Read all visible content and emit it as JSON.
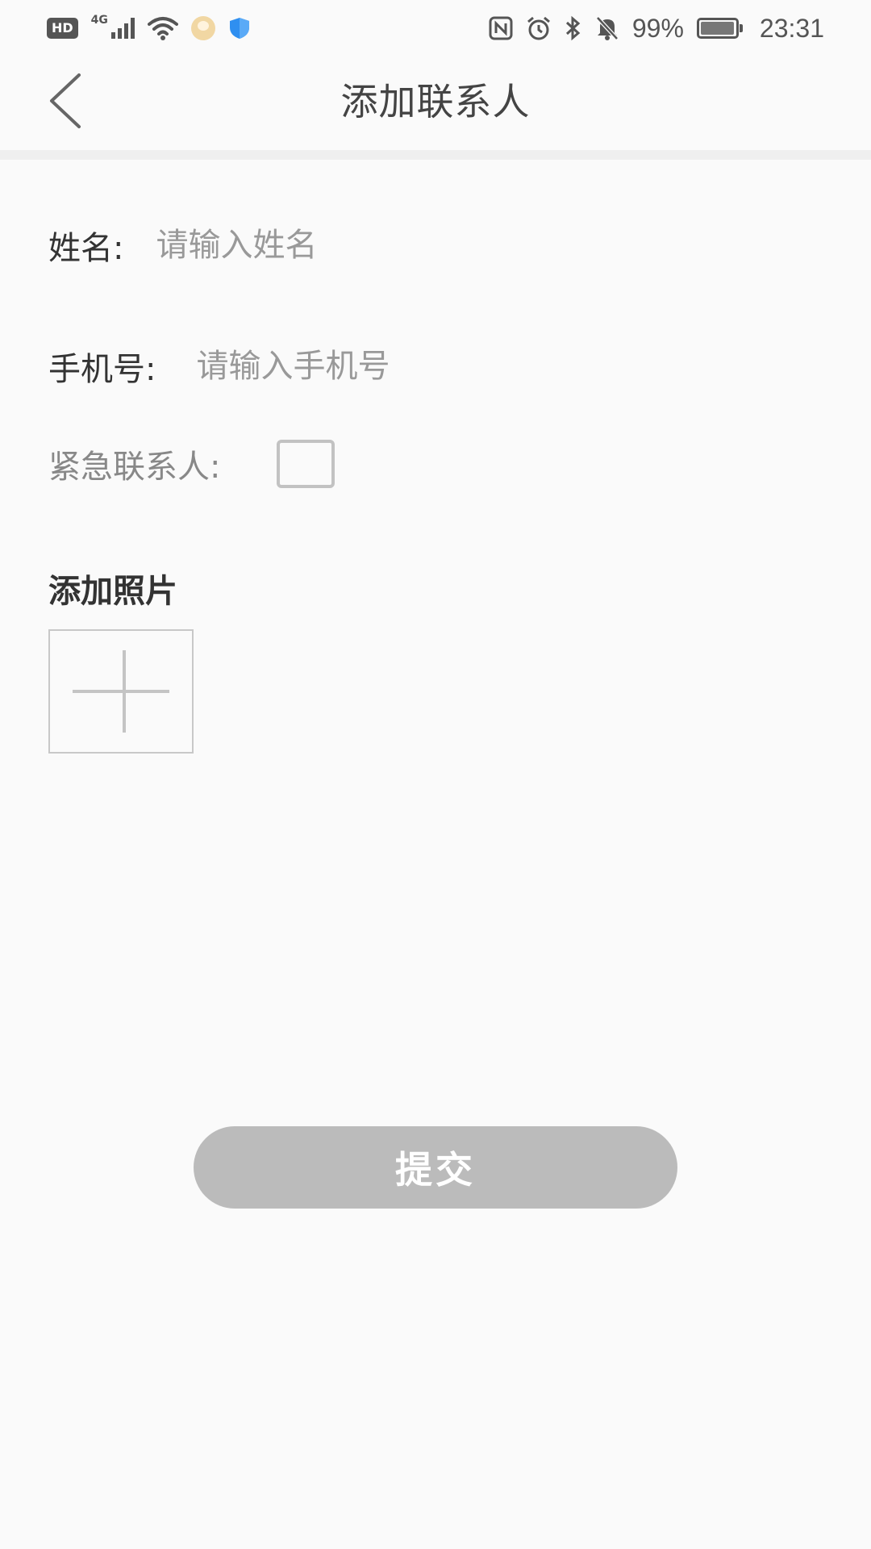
{
  "status_bar": {
    "hd_badge": "HD",
    "network_type": "4G",
    "battery_percent": "99%",
    "time": "23:31",
    "icons": [
      "hd-badge",
      "signal-icon",
      "wifi-icon",
      "app-avatar-icon",
      "shield-icon",
      "nfc-icon",
      "alarm-icon",
      "bluetooth-icon",
      "bell-off-icon",
      "battery-icon"
    ]
  },
  "header": {
    "title": "添加联系人",
    "back_icon": "chevron-left-icon"
  },
  "form": {
    "name_label": "姓名:",
    "name_placeholder": "请输入姓名",
    "name_value": "",
    "phone_label": "手机号:",
    "phone_placeholder": "请输入手机号",
    "phone_value": "",
    "emergency_label": "紧急联系人:",
    "emergency_checked": false
  },
  "photo": {
    "section_title": "添加照片",
    "add_icon": "plus-icon"
  },
  "submit": {
    "label": "提交"
  },
  "colors": {
    "background": "#fafafa",
    "divider": "#efefef",
    "submit_bg": "#bbbbbb",
    "border": "#c8c8c8"
  }
}
